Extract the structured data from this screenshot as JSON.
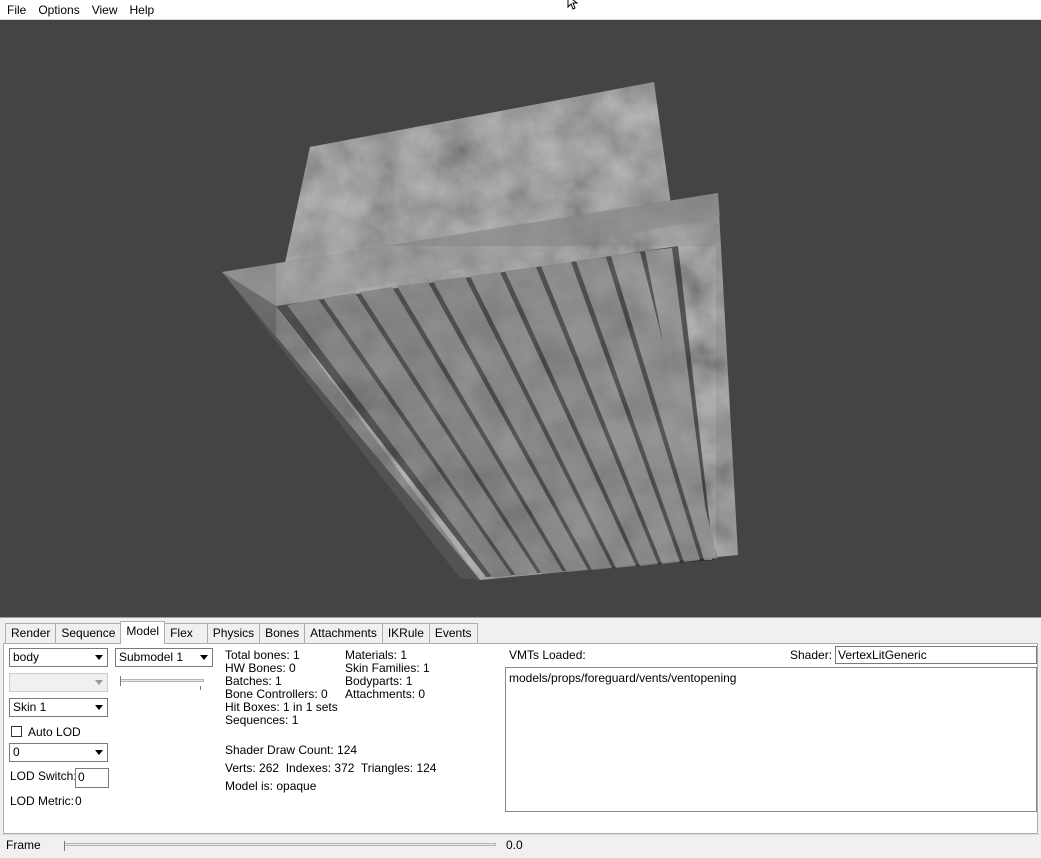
{
  "menu": {
    "file": "File",
    "options": "Options",
    "view": "View",
    "help": "Help"
  },
  "tabs": [
    "Render",
    "Sequence",
    "Model",
    "Flex",
    "Physics",
    "Bones",
    "Attachments",
    "IKRule",
    "Events"
  ],
  "active_tab": "Model",
  "model_tab": {
    "bodypart_select": "body",
    "submodel_select": "Submodel 1",
    "secondary_select": "",
    "skin_select": "Skin 1",
    "auto_lod_label": "Auto LOD",
    "lod_select": "0",
    "lod_switch_label": "LOD Switch:",
    "lod_switch_value": "0",
    "lod_metric_label": "LOD Metric:",
    "lod_metric_value": "0",
    "stats": {
      "total_bones": "Total bones: 1",
      "hw_bones": "HW Bones: 0",
      "batches": "Batches: 1",
      "bone_controllers": "Bone Controllers: 0",
      "hit_boxes": "Hit Boxes: 1 in 1 sets",
      "sequences": "Sequences: 1",
      "materials": "Materials: 1",
      "skin_families": "Skin Families: 1",
      "bodyparts": "Bodyparts: 1",
      "attachments": "Attachments: 0",
      "shader_draw_count": "Shader Draw Count: 124",
      "verts_line": "Verts: 262  Indexes: 372  Triangles: 124",
      "model_is": "Model is: opaque"
    },
    "vmts_label": "VMTs Loaded:",
    "shader_label": "Shader:",
    "shader_value": "VertexLitGeneric",
    "vmt_list": [
      "models/props/foreguard/vents/ventopening"
    ]
  },
  "frame": {
    "label": "Frame",
    "value": "0.0"
  },
  "colors": {
    "viewport_bg": "#444444",
    "panel_bg": "#f0f0f0"
  }
}
